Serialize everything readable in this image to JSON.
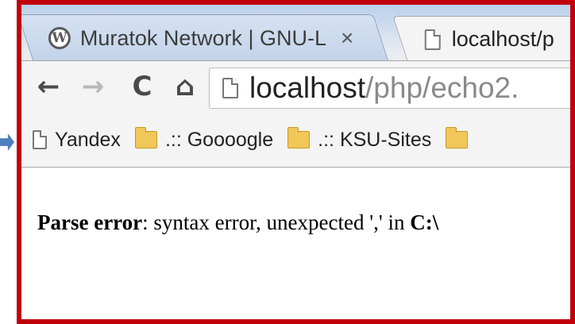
{
  "tabs": [
    {
      "title": "Muratok Network | GNU-L",
      "close": "×",
      "active": false
    },
    {
      "title": "localhost/p",
      "active": true
    }
  ],
  "toolbar": {
    "back_icon": "←",
    "forward_icon": "→",
    "reload_icon": "C",
    "home_icon": "⌂",
    "wp_icon": "W"
  },
  "omnibox": {
    "host": "localhost",
    "path": "/php/echo2."
  },
  "bookmarks": [
    {
      "label": "Yandex",
      "icon": "page-icon"
    },
    {
      "label": ".:: Goooogle",
      "icon": "folder-icon"
    },
    {
      "label": ".:: KSU-Sites",
      "icon": "folder-icon"
    }
  ],
  "content": {
    "error_label": "Parse error",
    "error_text": ": syntax error, unexpected ',' in ",
    "error_path": "C:\\"
  },
  "colors": {
    "frame": "#c0000a",
    "pointer": "#4f7fbf",
    "folder": "#f1c75a"
  }
}
